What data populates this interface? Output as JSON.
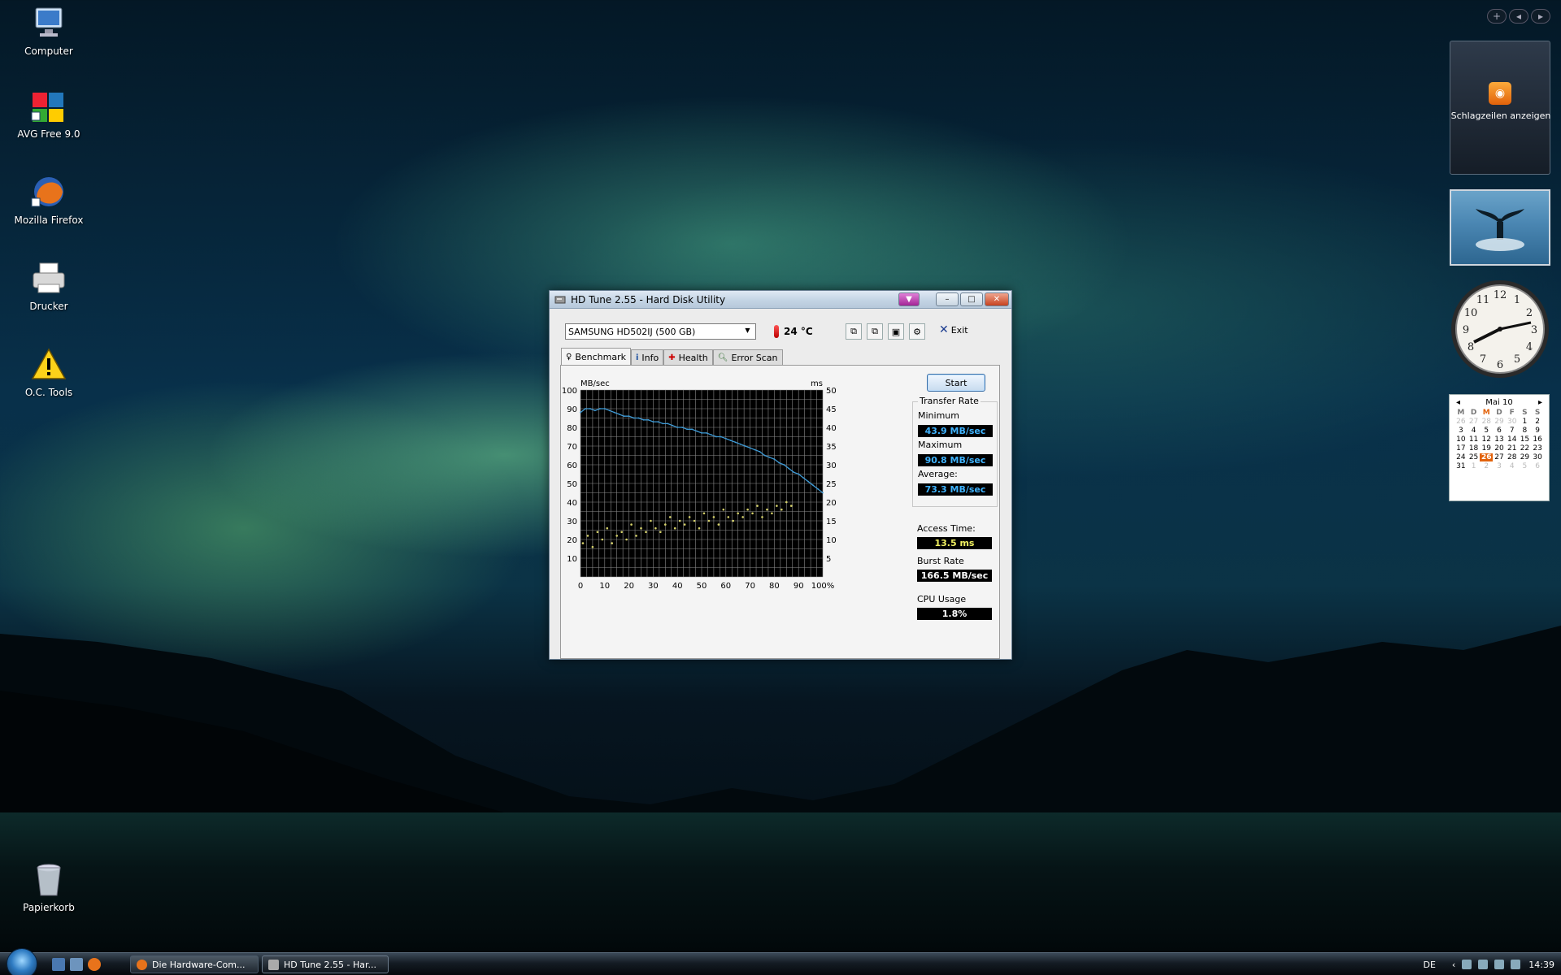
{
  "desktop": {
    "icons": [
      {
        "label": "Computer"
      },
      {
        "label": "AVG Free 9.0"
      },
      {
        "label": "Mozilla Firefox"
      },
      {
        "label": "Drucker"
      },
      {
        "label": "O.C. Tools"
      },
      {
        "label": "Papierkorb"
      }
    ]
  },
  "window": {
    "title": "HD Tune 2.55 - Hard Disk Utility",
    "drive": "SAMSUNG HD502IJ (500 GB)",
    "temperature": "24 °C",
    "exit_label": "Exit",
    "tabs": [
      {
        "label": "Benchmark",
        "icon": "benchmark-icon"
      },
      {
        "label": "Info",
        "icon": "info-icon"
      },
      {
        "label": "Health",
        "icon": "health-icon"
      },
      {
        "label": "Error Scan",
        "icon": "error-scan-icon"
      }
    ],
    "start_label": "Start",
    "transfer_rate": {
      "title": "Transfer Rate",
      "minimum_label": "Minimum",
      "minimum_value": "43.9 MB/sec",
      "maximum_label": "Maximum",
      "maximum_value": "90.8 MB/sec",
      "average_label": "Average:",
      "average_value": "73.3 MB/sec"
    },
    "access_time_label": "Access Time:",
    "access_time_value": "13.5 ms",
    "burst_rate_label": "Burst Rate",
    "burst_rate_value": "166.5 MB/sec",
    "cpu_usage_label": "CPU Usage",
    "cpu_usage_value": "1.8%",
    "colors": {
      "transfer_line": "#3f9bd6",
      "access_points": "#d6d26a"
    }
  },
  "chart_data": {
    "type": "line",
    "ylabel": "MB/sec",
    "y2label": "ms",
    "ylim": [
      0,
      100
    ],
    "y2lim": [
      0,
      50
    ],
    "xlim": [
      0,
      100
    ],
    "x_ticks": [
      "0",
      "10",
      "20",
      "30",
      "40",
      "50",
      "60",
      "70",
      "80",
      "90",
      "100%"
    ],
    "y_ticks": [
      "10",
      "20",
      "30",
      "40",
      "50",
      "60",
      "70",
      "80",
      "90",
      "100"
    ],
    "y2_ticks": [
      "5",
      "10",
      "15",
      "20",
      "25",
      "30",
      "35",
      "40",
      "45",
      "50"
    ],
    "grid": true,
    "series": [
      {
        "kind": "transfer",
        "x": [
          0,
          2,
          4,
          6,
          8,
          10,
          12,
          14,
          16,
          18,
          20,
          22,
          24,
          26,
          28,
          30,
          32,
          34,
          36,
          38,
          40,
          42,
          44,
          46,
          48,
          50,
          52,
          54,
          56,
          58,
          60,
          62,
          64,
          66,
          68,
          70,
          72,
          74,
          76,
          78,
          80,
          82,
          84,
          86,
          88,
          90,
          92,
          94,
          96,
          98,
          100
        ],
        "values": [
          88,
          90,
          90,
          89,
          90,
          90,
          89,
          88,
          87,
          86,
          86,
          85,
          85,
          84,
          84,
          83,
          83,
          82,
          82,
          81,
          80,
          80,
          79,
          79,
          78,
          77,
          77,
          76,
          75,
          75,
          74,
          73,
          72,
          71,
          70,
          69,
          68,
          67,
          65,
          64,
          63,
          61,
          60,
          58,
          56,
          55,
          53,
          51,
          49,
          47,
          45
        ]
      },
      {
        "kind": "access",
        "x": [
          1,
          3,
          5,
          7,
          9,
          11,
          13,
          15,
          17,
          19,
          21,
          23,
          25,
          27,
          29,
          31,
          33,
          35,
          37,
          39,
          41,
          43,
          45,
          47,
          49,
          51,
          53,
          55,
          57,
          59,
          61,
          63,
          65,
          67,
          69,
          71,
          73,
          75,
          77,
          79,
          81,
          83,
          85,
          87
        ],
        "values": [
          9,
          11,
          8,
          12,
          10,
          13,
          9,
          11,
          12,
          10,
          14,
          11,
          13,
          12,
          15,
          13,
          12,
          14,
          16,
          13,
          15,
          14,
          16,
          15,
          13,
          17,
          15,
          16,
          14,
          18,
          16,
          15,
          17,
          16,
          18,
          17,
          19,
          16,
          18,
          17,
          19,
          18,
          20,
          19
        ]
      }
    ]
  },
  "sidebar": {
    "feed_text": "Schlagzeilen anzeigen",
    "calendar": {
      "month": "Mai 10",
      "day_headers": [
        "M",
        "D",
        "M",
        "D",
        "F",
        "S",
        "S"
      ],
      "days_prev": [
        "26",
        "27",
        "28",
        "29",
        "30"
      ],
      "days": [
        "1",
        "2",
        "3",
        "4",
        "5",
        "6",
        "7",
        "8",
        "9",
        "10",
        "11",
        "12",
        "13",
        "14",
        "15",
        "16",
        "17",
        "18",
        "19",
        "20",
        "21",
        "22",
        "23",
        "24",
        "25",
        "26",
        "27",
        "28",
        "29",
        "30",
        "31"
      ],
      "days_next": [
        "1",
        "2",
        "3",
        "4",
        "5",
        "6"
      ],
      "today": "26"
    }
  },
  "taskbar": {
    "tasks": [
      {
        "label": "Die Hardware-Com..."
      },
      {
        "label": "HD Tune 2.55 - Har..."
      }
    ],
    "lang": "DE",
    "time": "14:39"
  }
}
